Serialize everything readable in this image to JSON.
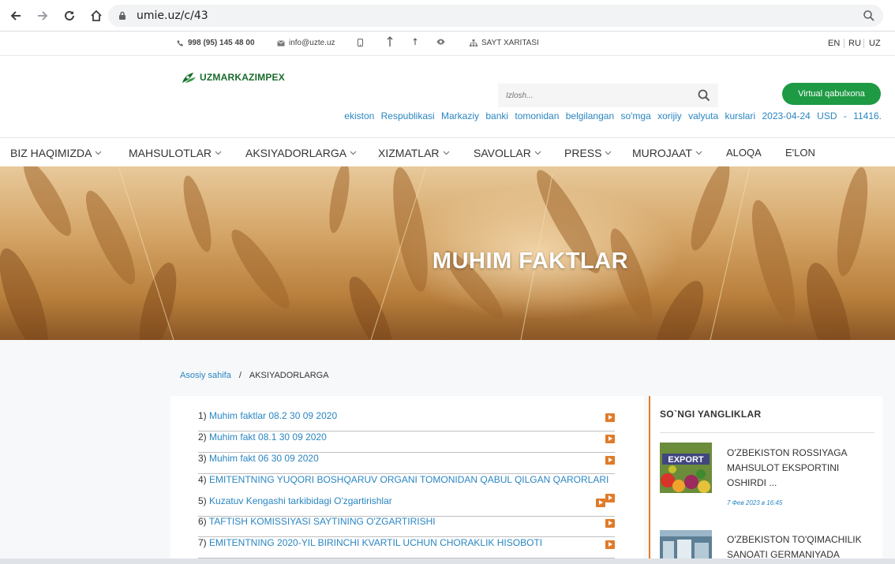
{
  "browser": {
    "url": "umie.uz/c/43"
  },
  "topbar": {
    "phone": "998 (95) 145 48 00",
    "email": "info@uzte.uz",
    "sitemap": "SAYT XARITASI",
    "languages": [
      "EN",
      "RU",
      "UZ"
    ]
  },
  "header": {
    "logo_text": "UZMARKAZIMPEX",
    "search_placeholder": "Izlosh...",
    "virtual_button": "Virtual qabulxona",
    "ticker": "ekiston Respublikasi Markaziy banki tomonidan belgilangan so'mga xorijiy valyuta kurslari 2023-04-24 USD - 11416."
  },
  "nav": {
    "items": [
      "BIZ HAQIMIZDA",
      "MAHSULOTLAR",
      "AKSIYADORLARGA",
      "XIZMATLAR",
      "SAVOLLAR",
      "PRESS",
      "MUROJAAT",
      "ALOQA",
      "E'LON"
    ]
  },
  "hero": {
    "title": "MUHIM FAKTLAR"
  },
  "breadcrumb": {
    "home": "Asosiy sahifa",
    "separator": "/",
    "current": "AKSIYADORLARGA"
  },
  "documents": [
    {
      "num": "1)",
      "title": "Muhim faktlar 08.2 30 09 2020"
    },
    {
      "num": "2)",
      "title": "Muhim fakt 08.1 30 09 2020"
    },
    {
      "num": "3)",
      "title": "Muhim fakt 06 30 09 2020"
    },
    {
      "num": "4)",
      "title": "EMITENTNING YUQORI BOSHQARUV ORGANI TOMONIDAN QABUL QILGAN QARORLARI"
    },
    {
      "num": "5)",
      "title": "Kuzatuv Kengashi tarkibidagi O'zgartirishlar"
    },
    {
      "num": "6)",
      "title": "TAFTISH KOMISSIYASI SAYTINING O'ZGARTIRISHI"
    },
    {
      "num": "7)",
      "title": "EMITENTNING 2020-YIL BIRINCHI KVARTIL UCHUN CHORAKLIK HISOBOTI"
    }
  ],
  "news": {
    "heading": "SO`NGI YANGLIKLAR",
    "items": [
      {
        "title": "O'ZBEKISTON ROSSIYAGA MAHSULOT EKSPORTINI OSHIRDI ...",
        "date": "7 Фев 2023 в 16:45",
        "thumb_label": "EXPORT"
      },
      {
        "title": "O'ZBEKISTON TO'QIMACHILIK SANOATI GERMANIYADA",
        "date": ""
      }
    ]
  },
  "colors": {
    "accent_green": "#1e9a44",
    "link_blue": "#2a86c2",
    "accent_orange": "#e07b2a"
  }
}
